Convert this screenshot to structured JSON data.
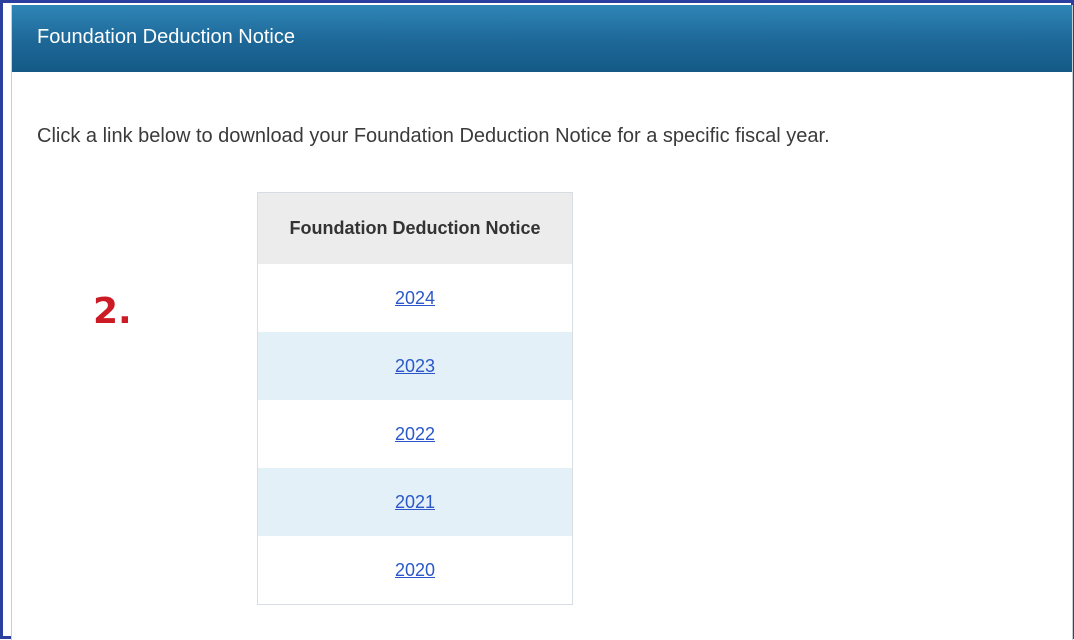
{
  "panel": {
    "title": "Foundation Deduction Notice",
    "intro": "Click a link below to download your Foundation Deduction Notice for a specific fiscal year."
  },
  "annotation": {
    "step_label": "2.",
    "color": "#cc1b24"
  },
  "table": {
    "header": "Foundation Deduction Notice",
    "years": [
      "2024",
      "2023",
      "2022",
      "2021",
      "2020"
    ]
  },
  "colors": {
    "header_bg": "#1d6797",
    "link": "#2b57c9",
    "alt_row": "#e4f0f8",
    "frame_border": "#2b3f9e"
  }
}
